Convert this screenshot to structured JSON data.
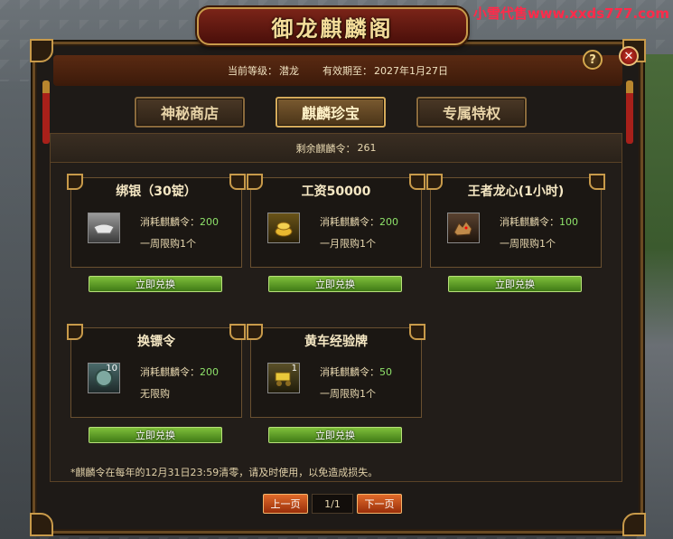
{
  "watermark": "小雪代售www.xxds777.com",
  "window_title": "御龙麒麟阁",
  "header": {
    "level_label": "当前等级：",
    "level_value": "潜龙",
    "expiry_label": "有效期至：",
    "expiry_value": "2027年1月27日",
    "help_label": "?",
    "close_label": "✕"
  },
  "tabs": [
    {
      "label": "神秘商店",
      "active": false
    },
    {
      "label": "麒麟珍宝",
      "active": true
    },
    {
      "label": "专属特权",
      "active": false
    }
  ],
  "remaining": {
    "label": "剩余麒麟令：",
    "value": "261"
  },
  "items": [
    {
      "name": "绑银（30锭）",
      "cost_label": "消耗麒麟令：",
      "cost": "200",
      "limit": "一周限购1个",
      "icon": "silver-ingot-icon",
      "qty": "",
      "button": "立即兑换"
    },
    {
      "name": "工资50000",
      "cost_label": "消耗麒麟令：",
      "cost": "200",
      "limit": "一月限购1个",
      "icon": "gold-coins-icon",
      "qty": "",
      "button": "立即兑换"
    },
    {
      "name": "王者龙心(1小时)",
      "cost_label": "消耗麒麟令：",
      "cost": "100",
      "limit": "一周限购1个",
      "icon": "dragon-head-icon",
      "qty": "",
      "button": "立即兑换"
    },
    {
      "name": "换镖令",
      "cost_label": "消耗麒麟令：",
      "cost": "200",
      "limit": "无限购",
      "icon": "token-coin-icon",
      "qty": "10",
      "button": "立即兑换"
    },
    {
      "name": "黄车经验牌",
      "cost_label": "消耗麒麟令：",
      "cost": "50",
      "limit": "一周限购1个",
      "icon": "yellow-cart-icon",
      "qty": "1",
      "button": "立即兑换"
    }
  ],
  "note": "*麒麟令在每年的12月31日23:59清零，请及时使用，以免造成损失。",
  "pager": {
    "prev": "上一页",
    "page": "1/1",
    "next": "下一页"
  },
  "colors": {
    "accent_green": "#8ee26a",
    "button_green": "#5a9a26",
    "pager_orange": "#c84a1a",
    "gold": "#c89a4a"
  }
}
